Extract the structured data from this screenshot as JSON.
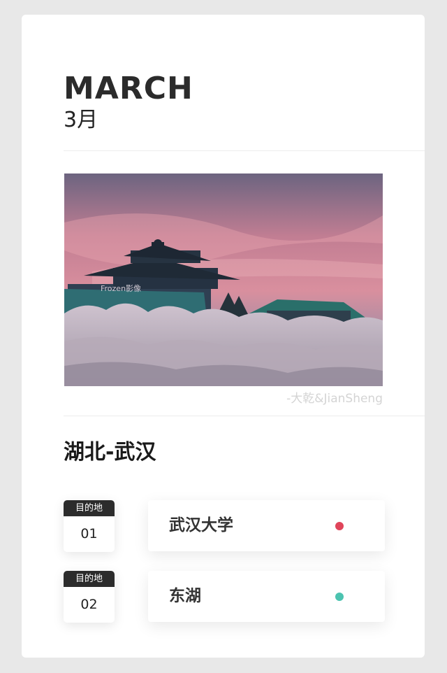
{
  "header": {
    "month_en": "MARCH",
    "month_cn": "3月"
  },
  "photo": {
    "watermark": "Frozen影像",
    "credit": "-大乾&JianSheng"
  },
  "region": {
    "title": "湖北-武汉"
  },
  "destinations": [
    {
      "badge_label": "目的地",
      "number": "01",
      "name": "武汉大学",
      "dot_color": "#e0455a"
    },
    {
      "badge_label": "目的地",
      "number": "02",
      "name": "东湖",
      "dot_color": "#4cc3b0"
    }
  ]
}
